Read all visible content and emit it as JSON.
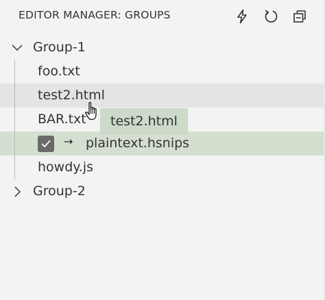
{
  "header": {
    "title": "EDITOR MANAGER: GROUPS",
    "actions": [
      {
        "icon": "lightning-icon"
      },
      {
        "icon": "refresh-icon"
      },
      {
        "icon": "collapse-all-icon"
      }
    ]
  },
  "tree": {
    "groups": [
      {
        "label": "Group-1",
        "expanded": true,
        "files": [
          {
            "label": "foo.txt"
          },
          {
            "label": "test2.html",
            "state": "hover"
          },
          {
            "label": "BAR.txt"
          },
          {
            "label": "plaintext.hsnips",
            "state": "drop-target",
            "checked": true,
            "arrow": "→"
          },
          {
            "label": "howdy.js"
          }
        ]
      },
      {
        "label": "Group-2",
        "expanded": false
      }
    ]
  },
  "drag": {
    "label": "test2.html"
  },
  "colors": {
    "background": "#f3f3f3",
    "hover": "#e4e4e4",
    "drop_target": "#d5dfd0",
    "checkbox": "#6a6a6a"
  }
}
